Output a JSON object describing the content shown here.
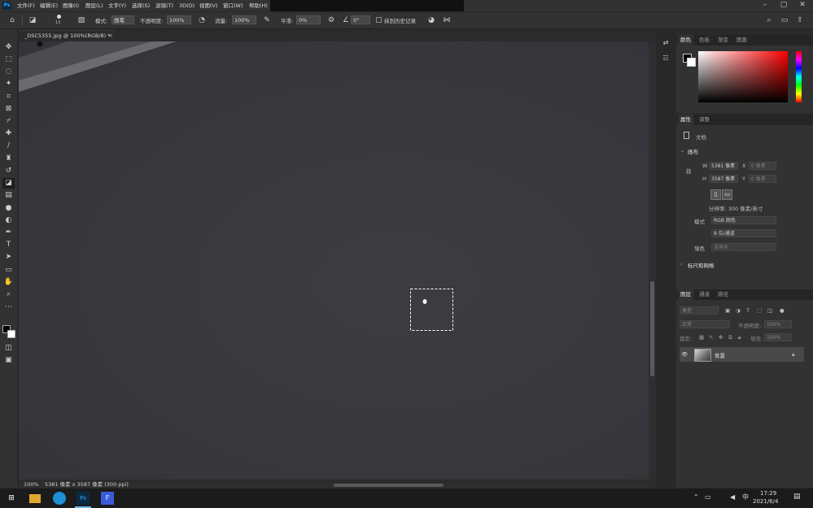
{
  "menubar": {
    "items": [
      "文件(F)",
      "编辑(E)",
      "图像(I)",
      "图层(L)",
      "文字(Y)",
      "选择(S)",
      "滤镜(T)",
      "3D(D)",
      "视图(V)",
      "窗口(W)",
      "帮助(H)"
    ],
    "logo": "Ps"
  },
  "options": {
    "brush_size": "13",
    "mode_label": "模式:",
    "mode_value": "画笔",
    "opacity_label": "不透明度:",
    "opacity_value": "100%",
    "flow_label": "流量:",
    "flow_value": "100%",
    "smoothing_label": "平滑:",
    "smoothing_value": "0%",
    "angle_value": "0°",
    "history_label": "抹到历史记录"
  },
  "document": {
    "tab_title": "_DSC5355.jpg @ 100%(RGB/8) *",
    "zoom": "100%",
    "dimensions": "5381 像素 x 3587 像素 (300 ppi)"
  },
  "color_panel": {
    "tabs": [
      "颜色",
      "色板",
      "渐变",
      "图案"
    ]
  },
  "properties_panel": {
    "tabs": [
      "属性",
      "调整"
    ],
    "doc_label": "文档",
    "canvas_header": "画布",
    "w_label": "W",
    "w_value": "5381 像素",
    "x_label": "X",
    "x_value": "0 像素",
    "h_label": "H",
    "h_value": "3587 像素",
    "y_label": "Y",
    "y_value": "0 像素",
    "resolution": "分辨率: 300 像素/英寸",
    "mode_label": "模式",
    "mode_value": "RGB 颜色",
    "depth_value": "8 位/通道",
    "fill_label": "填色",
    "fill_value": "背景色",
    "rulers_header": "标尺和网格"
  },
  "layers_panel": {
    "tabs": [
      "图层",
      "通道",
      "路径"
    ],
    "filter_placeholder": "类型",
    "blend_mode": "正常",
    "opacity_label": "不透明度:",
    "opacity_value": "100%",
    "lock_label": "锁定:",
    "fill_label": "填充:",
    "fill_value": "100%",
    "layer_name": "背景"
  },
  "taskbar": {
    "time": "17:29",
    "date": "2021/6/4",
    "ime": "中"
  },
  "colors": {
    "accent": "#31a8ff",
    "canvas": "#38383d",
    "panel": "#323232"
  }
}
